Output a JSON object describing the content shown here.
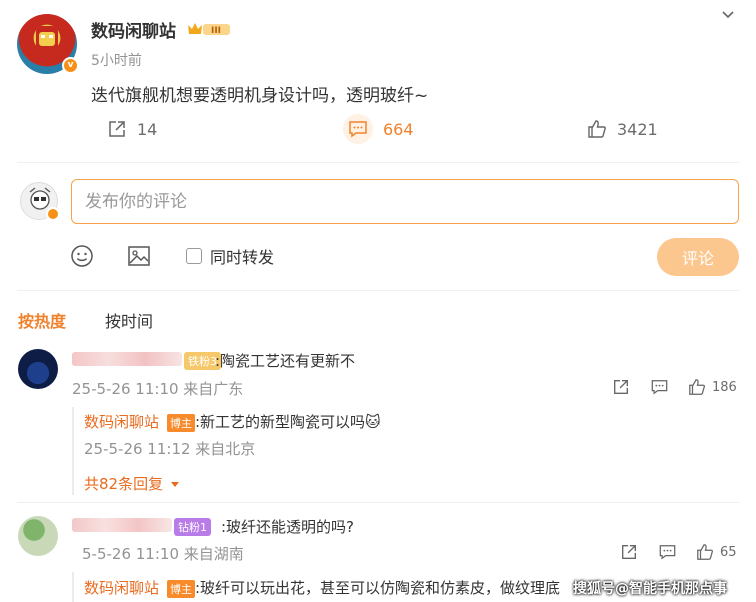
{
  "post": {
    "username": "数码闲聊站",
    "level_badge": "III",
    "verified_badge": "v",
    "time": "5小时前",
    "content": "迭代旗舰机想要透明机身设计吗，透明玻纤~",
    "reposts": "14",
    "comments": "664",
    "likes": "3421"
  },
  "composer": {
    "placeholder": "发布你的评论",
    "repost_label": "同时转发",
    "submit_label": "评论"
  },
  "sort": {
    "hot_label": "按热度",
    "time_label": "按时间"
  },
  "comments": [
    {
      "fan_badge": "铁粉3",
      "text": ":陶瓷工艺还有更新不",
      "meta": "25-5-26 11:10 来自广东",
      "likes": "186",
      "reply": {
        "username": "数码闲聊站",
        "role_badge": "博主",
        "text": ":新工艺的新型陶瓷可以吗🐱",
        "meta": "25-5-26 11:12 来自北京"
      },
      "more_replies": "共82条回复"
    },
    {
      "fan_badge": "钻粉1",
      "text": ":玻纤还能透明的吗?",
      "meta": "5-5-26 11:10 来自湖南",
      "likes": "65",
      "reply": {
        "username": "数码闲聊站",
        "role_badge": "博主",
        "text": ":玻纤可以玩出花，甚至可以仿陶瓷和仿素皮，做纹理底"
      }
    }
  ],
  "watermark": "搜狐号@智能手机那点事",
  "colors": {
    "accent": "#f0822d",
    "link": "#e86b1f",
    "input_border": "#f8a34a",
    "submit_bg": "#fbc78f"
  }
}
